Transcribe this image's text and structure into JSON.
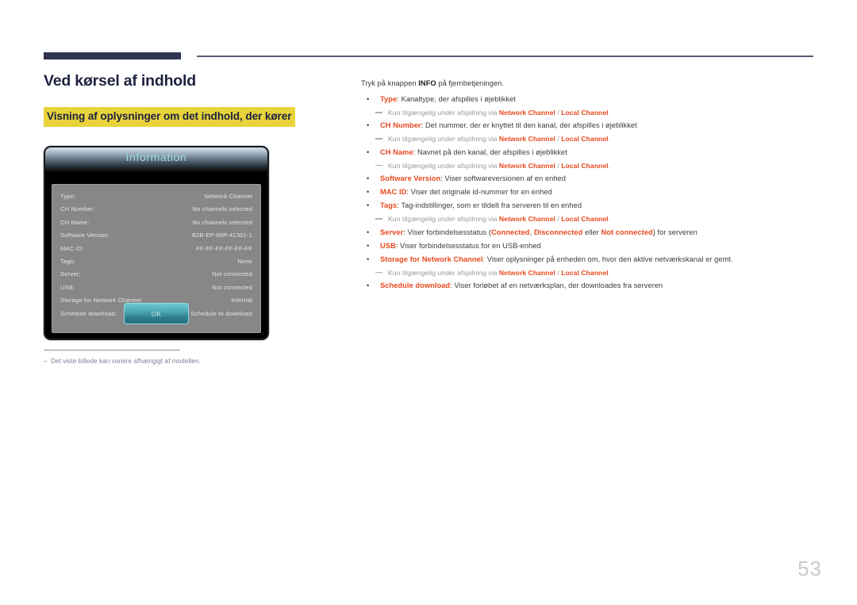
{
  "page": {
    "number": "53"
  },
  "left": {
    "title": "Ved kørsel af indhold",
    "section_heading": "Visning af oplysninger om det indhold, der kører",
    "footnote": "Det viste billede kan variere afhængigt af modellen.",
    "footnote_dash": "–"
  },
  "dialog": {
    "title": "Information",
    "ok_label": "OK",
    "rows": [
      {
        "label": "Type:",
        "value": "Network Channel"
      },
      {
        "label": "CH Number:",
        "value": "No channels selected"
      },
      {
        "label": "CH Name:",
        "value": "No channels selected"
      },
      {
        "label": "Software Version:",
        "value": "B2B-EP-MIP-41301-1"
      },
      {
        "label": "MAC ID:",
        "value": "FF-FF-FF-FF-FF-FF"
      },
      {
        "label": "Tags:",
        "value": "None"
      },
      {
        "label": "Server:",
        "value": "Not connected"
      },
      {
        "label": "USB:",
        "value": "Not connected"
      },
      {
        "label": "Storage for Network Channel:",
        "value": "Internal"
      },
      {
        "label": "Schedule download:",
        "value": "No Schedule to download"
      }
    ]
  },
  "right": {
    "intro_prefix": "Tryk på knappen ",
    "intro_bold": "INFO",
    "intro_suffix": " på fjernbetjeningen.",
    "sub_note_prefix": "Kun tilgængelig under afspilning via ",
    "sub_note_ch1": "Network Channel",
    "sub_note_sep": " / ",
    "sub_note_ch2": "Local Channel",
    "sub_note_end": ".",
    "bullets": [
      {
        "term": "Type",
        "text": ": Kanaltype, der afspilles i øjeblikket",
        "sub": true
      },
      {
        "term": "CH Number",
        "text": ": Det nummer, der er knyttet til den kanal, der afspilles i øjeblikket",
        "sub": true
      },
      {
        "term": "CH Name",
        "text": ": Navnet på den kanal, der afspilles i øjeblikket",
        "sub": true
      },
      {
        "term": "Software Version",
        "text": ": Viser softwareversionen af en enhed",
        "sub": false
      },
      {
        "term": "MAC ID",
        "text": ": Viser det originale id-nummer for en enhed",
        "sub": false
      },
      {
        "term": "Tags",
        "text": ": Tag-indstillinger, som er tildelt fra serveren til en enhed",
        "sub": true
      },
      {
        "term": "Server",
        "text": ": Viser forbindelsesstatus (",
        "inline_kw1": "Connected",
        "inline_mid1": ", ",
        "inline_kw2": "Disconnected",
        "inline_mid2": " eller ",
        "inline_kw3": "Not connected",
        "text_end": ") for serveren",
        "sub": false
      },
      {
        "term": "USB",
        "text": ": Viser forbindelsesstatus for en USB-enhed",
        "sub": false
      },
      {
        "term": "Storage for Network Channel",
        "text": ": Viser oplysninger på enheden om, hvor den aktive netværkskanal er gemt.",
        "sub": true
      },
      {
        "term": "Schedule download",
        "text": ": Viser forløbet af en netværksplan, der downloades fra serveren",
        "sub": false
      }
    ],
    "bullet_glyph": "•"
  },
  "colors": {
    "accent_red": "#e8491f",
    "navy": "#2e3352",
    "highlight_yellow": "#e8d33b",
    "osd_title_cyan": "#9fdbe8"
  }
}
